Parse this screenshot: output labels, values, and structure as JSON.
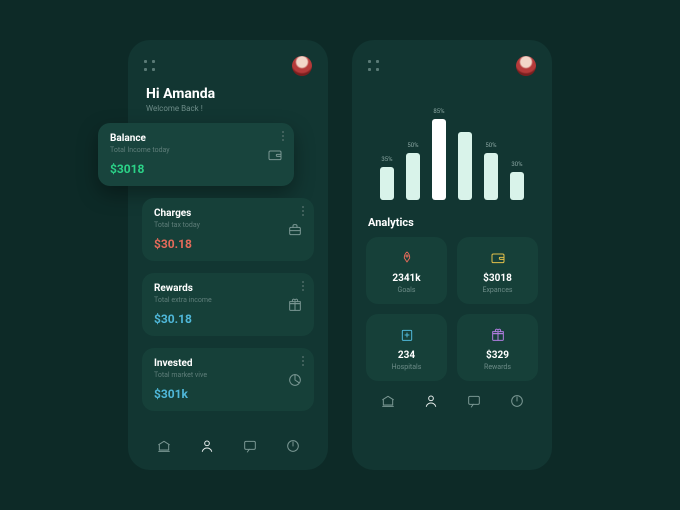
{
  "left": {
    "greeting_title": "Hi Amanda",
    "greeting_sub": "Welcome Back !",
    "cards": [
      {
        "title": "Balance",
        "sub": "Total Income today",
        "value": "$3018",
        "value_class": "val-green",
        "icon": "wallet",
        "pop": true
      },
      {
        "title": "Charges",
        "sub": "Total tax today",
        "value": "$30.18",
        "value_class": "val-red",
        "icon": "briefcase",
        "pop": false
      },
      {
        "title": "Rewards",
        "sub": "Total extra income",
        "value": "$30.18",
        "value_class": "val-blue",
        "icon": "gift",
        "pop": false
      },
      {
        "title": "Invested",
        "sub": "Total market vive",
        "value": "$301k",
        "value_class": "val-blue",
        "icon": "pie",
        "pop": false
      }
    ]
  },
  "right": {
    "analytics_title": "Analytics",
    "tiles": [
      {
        "icon": "rocket",
        "icon_color": "#e36a5a",
        "value": "2341k",
        "label": "Goals"
      },
      {
        "icon": "wallet",
        "icon_color": "#e2c04a",
        "value": "$3018",
        "label": "Expances"
      },
      {
        "icon": "hospital",
        "icon_color": "#4fb7d8",
        "value": "234",
        "label": "Hospitals"
      },
      {
        "icon": "gift",
        "icon_color": "#b07de0",
        "value": "$329",
        "label": "Rewards"
      }
    ]
  },
  "tabs": [
    "bank",
    "user",
    "chat",
    "power"
  ],
  "active_tab": {
    "left": 1,
    "right": 1
  },
  "chart_data": {
    "type": "bar",
    "title": "",
    "xlabel": "",
    "ylabel": "",
    "ylim": [
      0,
      100
    ],
    "categories": [
      "",
      "",
      "",
      "",
      "",
      ""
    ],
    "labels": [
      "35%",
      "50%",
      "85%",
      "",
      "50%",
      "30%"
    ],
    "values": [
      35,
      50,
      85,
      72,
      50,
      30
    ],
    "peak_index": 2
  },
  "colors": {
    "bg": "#0d2a27",
    "panel": "#123632",
    "card": "#164039",
    "accent_green": "#2bd187",
    "accent_red": "#e36a5a",
    "accent_blue": "#4fb7d8",
    "accent_yellow": "#e2c04a",
    "accent_purple": "#b07de0"
  }
}
